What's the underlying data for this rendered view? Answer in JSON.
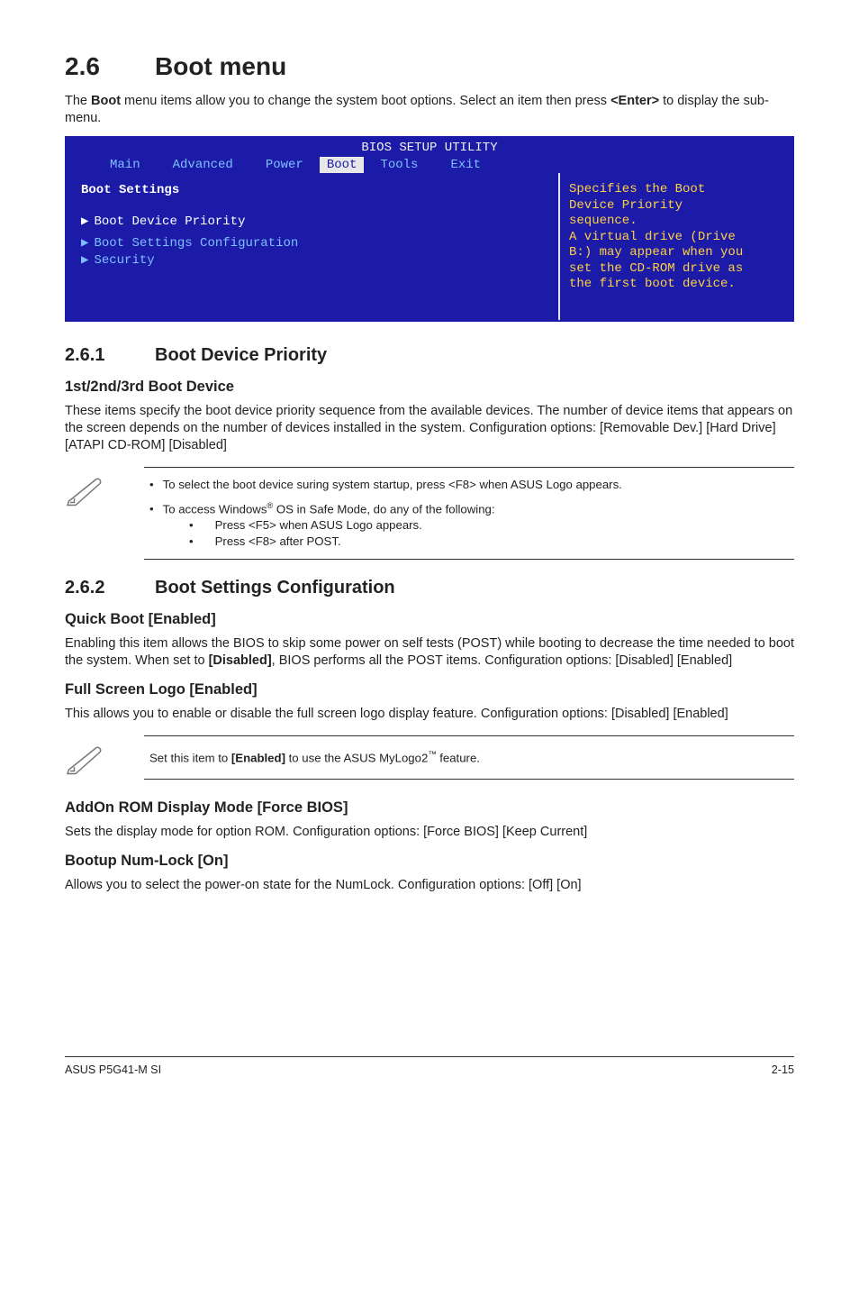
{
  "section": {
    "number": "2.6",
    "title": "Boot menu"
  },
  "intro_parts": [
    "The ",
    "Boot",
    " menu items allow you to change the system boot options. Select an item then press ",
    "<Enter>",
    " to display the sub-menu."
  ],
  "bios": {
    "utility_title": "BIOS SETUP UTILITY",
    "tabs": [
      "Main",
      "Advanced",
      "Power",
      "Boot",
      "Tools",
      "Exit"
    ],
    "active_tab_index": 3,
    "left_header": "Boot Settings",
    "items": [
      "Boot Device Priority",
      "Boot Settings Configuration",
      "Security"
    ],
    "selected_index": 0,
    "help_lines": [
      "Specifies the Boot",
      "Device Priority",
      "sequence.",
      "",
      "A virtual drive (Drive",
      "B:) may appear when you",
      "set the CD-ROM drive as",
      "the first boot device."
    ]
  },
  "sub261": {
    "number": "2.6.1",
    "title": "Boot Device Priority",
    "h3": "1st/2nd/3rd Boot Device",
    "body": "These items specify the boot device priority sequence from the available devices. The number of device items that appears on the screen depends on the number of devices installed in the system. Configuration options: [Removable Dev.] [Hard Drive] [ATAPI CD-ROM] [Disabled]"
  },
  "note1": {
    "b1": "To select the boot device suring system startup, press <F8> when ASUS Logo appears.",
    "b2_pre": "To access Windows",
    "b2_sup": "®",
    "b2_post": " OS in Safe Mode, do any of the following:",
    "b2a": "Press <F5> when ASUS Logo appears.",
    "b2b": "Press <F8> after POST."
  },
  "sub262": {
    "number": "2.6.2",
    "title": "Boot Settings Configuration"
  },
  "qb": {
    "h": "Quick Boot [Enabled]",
    "p": [
      "Enabling this item allows the BIOS to skip some power on self tests (POST) while booting to decrease the time needed to boot the system. When set to ",
      "[Disabled]",
      ", BIOS performs all the POST items. Configuration options: [Disabled] [Enabled]"
    ]
  },
  "fsl": {
    "h": "Full Screen Logo [Enabled]",
    "p": "This allows you to enable or disable the full screen logo display feature. Configuration options: [Disabled] [Enabled]"
  },
  "note2": {
    "pre": "Set this item to ",
    "bold": "[Enabled]",
    "mid": " to use the ASUS MyLogo2",
    "sup": "™",
    "post": " feature."
  },
  "addon": {
    "h": "AddOn ROM Display Mode [Force BIOS]",
    "p": "Sets the display mode for option ROM. Configuration options: [Force BIOS] [Keep Current]"
  },
  "numlock": {
    "h": "Bootup Num-Lock [On]",
    "p": "Allows you to select the power-on state for the NumLock. Configuration options: [Off] [On]"
  },
  "footer": {
    "left": "ASUS P5G41-M SI",
    "right": "2-15"
  }
}
